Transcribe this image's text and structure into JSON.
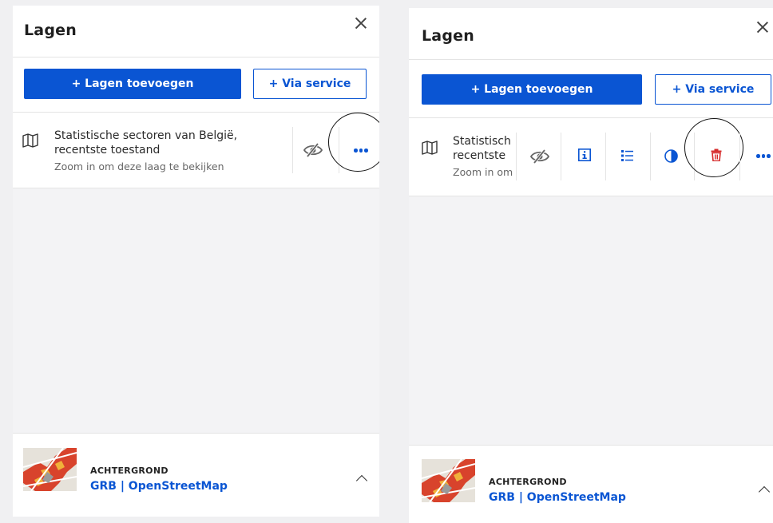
{
  "left_panel": {
    "title": "Lagen",
    "add_layers_label": "+ Lagen toevoegen",
    "via_service_label": "+ Via service",
    "layer": {
      "title_line1": "Statistische sectoren van België,",
      "title_line2": "recentste toestand",
      "subtitle": "Zoom in om deze laag te bekijken"
    },
    "background": {
      "label": "ACHTERGROND",
      "value": "GRB | OpenStreetMap"
    }
  },
  "right_panel": {
    "title": "Lagen",
    "add_layers_label": "+ Lagen toevoegen",
    "via_service_label": "+ Via service",
    "layer": {
      "title_line1": "Statistisch",
      "title_line2": "recentste",
      "subtitle": "Zoom in om"
    },
    "tools": [
      "eye-slash-icon",
      "info-icon",
      "legend-icon",
      "contrast-icon",
      "trash-icon",
      "more-icon"
    ],
    "background": {
      "label": "ACHTERGROND",
      "value": "GRB | OpenStreetMap"
    }
  },
  "colors": {
    "primary": "#0a55d3",
    "danger": "#d62a2a",
    "panel_bg": "#ffffff",
    "empty_bg": "#f3f3f5"
  }
}
